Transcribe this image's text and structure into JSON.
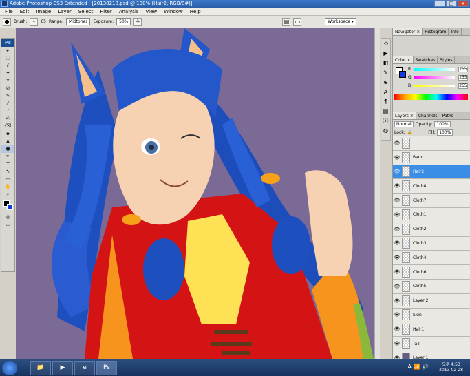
{
  "window": {
    "title": "Adobe Photoshop CS3 Extended - [20130218.psd @ 100% (Hair2, RGB/8#)]",
    "controls": [
      "_",
      "□",
      "x"
    ]
  },
  "menu": [
    "File",
    "Edit",
    "Image",
    "Layer",
    "Select",
    "Filter",
    "Analysis",
    "View",
    "Window",
    "Help"
  ],
  "options": {
    "brush_label": "Brush:",
    "brush_size": "65",
    "range_label": "Range:",
    "range_value": "Midtones",
    "exposure_label": "Exposure:",
    "exposure_value": "50%",
    "workspace_label": "Workspace ▾"
  },
  "tools": [
    "▸",
    "⬚",
    "ℓ",
    "✦",
    "⌗",
    "⊘",
    "✎",
    "⁄",
    "♪",
    "✍",
    "⌫",
    "◆",
    "▲",
    "●",
    "✒",
    "T",
    "↖",
    "▭",
    "✋",
    "⌕"
  ],
  "panels": {
    "nav_tabs": [
      "Navigator ×",
      "Histogram",
      "Info"
    ],
    "color_tabs": [
      "Color ×",
      "Swatches",
      "Styles"
    ],
    "color": {
      "r_label": "R",
      "r_value": "255",
      "g_label": "G",
      "g_value": "255",
      "b_label": "B",
      "b_value": "255"
    },
    "layer_tabs": [
      "Layers ×",
      "Channels",
      "Paths"
    ],
    "blend_mode": "Normal",
    "opacity_label": "Opacity:",
    "opacity_value": "100%",
    "lock_label": "Lock:",
    "fill_label": "Fill:",
    "fill_value": "100%",
    "layers": [
      {
        "name": "---------------",
        "selected": false
      },
      {
        "name": "Band",
        "selected": false
      },
      {
        "name": "Hair2",
        "selected": true
      },
      {
        "name": "Cloth8",
        "selected": false
      },
      {
        "name": "Cloth7",
        "selected": false
      },
      {
        "name": "Cloth1",
        "selected": false
      },
      {
        "name": "Cloth2",
        "selected": false
      },
      {
        "name": "Cloth3",
        "selected": false
      },
      {
        "name": "Cloth4",
        "selected": false
      },
      {
        "name": "Cloth6",
        "selected": false
      },
      {
        "name": "Cloth5",
        "selected": false
      },
      {
        "name": "Layer 2",
        "selected": false
      },
      {
        "name": "Skin",
        "selected": false
      },
      {
        "name": "Hair1",
        "selected": false
      },
      {
        "name": "Tail",
        "selected": false
      },
      {
        "name": "Layer 1",
        "selected": false
      }
    ]
  },
  "taskbar": {
    "items": [
      "📁",
      "▶",
      "e",
      "Ps"
    ],
    "tray": "A 📶 🔊",
    "clock_time": "오후 4:53",
    "clock_date": "2013-02-28"
  }
}
